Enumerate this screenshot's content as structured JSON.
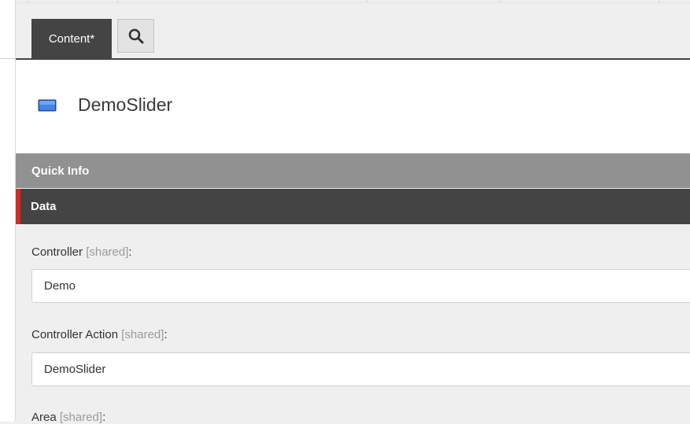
{
  "tabs": {
    "content_label": "Content*",
    "search_icon": "search-icon"
  },
  "header": {
    "title": "DemoSlider",
    "icon": "document-type-icon",
    "icon_color": "#2f6fd6"
  },
  "panels": {
    "quick_info": "Quick Info",
    "data": "Data"
  },
  "fields": [
    {
      "label": "Controller",
      "shared": "[shared]",
      "suffix": ":",
      "value": "Demo"
    },
    {
      "label": "Controller Action",
      "shared": "[shared]",
      "suffix": ":",
      "value": "DemoSlider"
    },
    {
      "label": "Area",
      "shared": "[shared]",
      "suffix": ":"
    }
  ],
  "colors": {
    "active_tab": "#444444",
    "quick_info_bar": "#919191",
    "data_bar": "#444444",
    "accent": "#d32a22",
    "background": "#efefef"
  }
}
